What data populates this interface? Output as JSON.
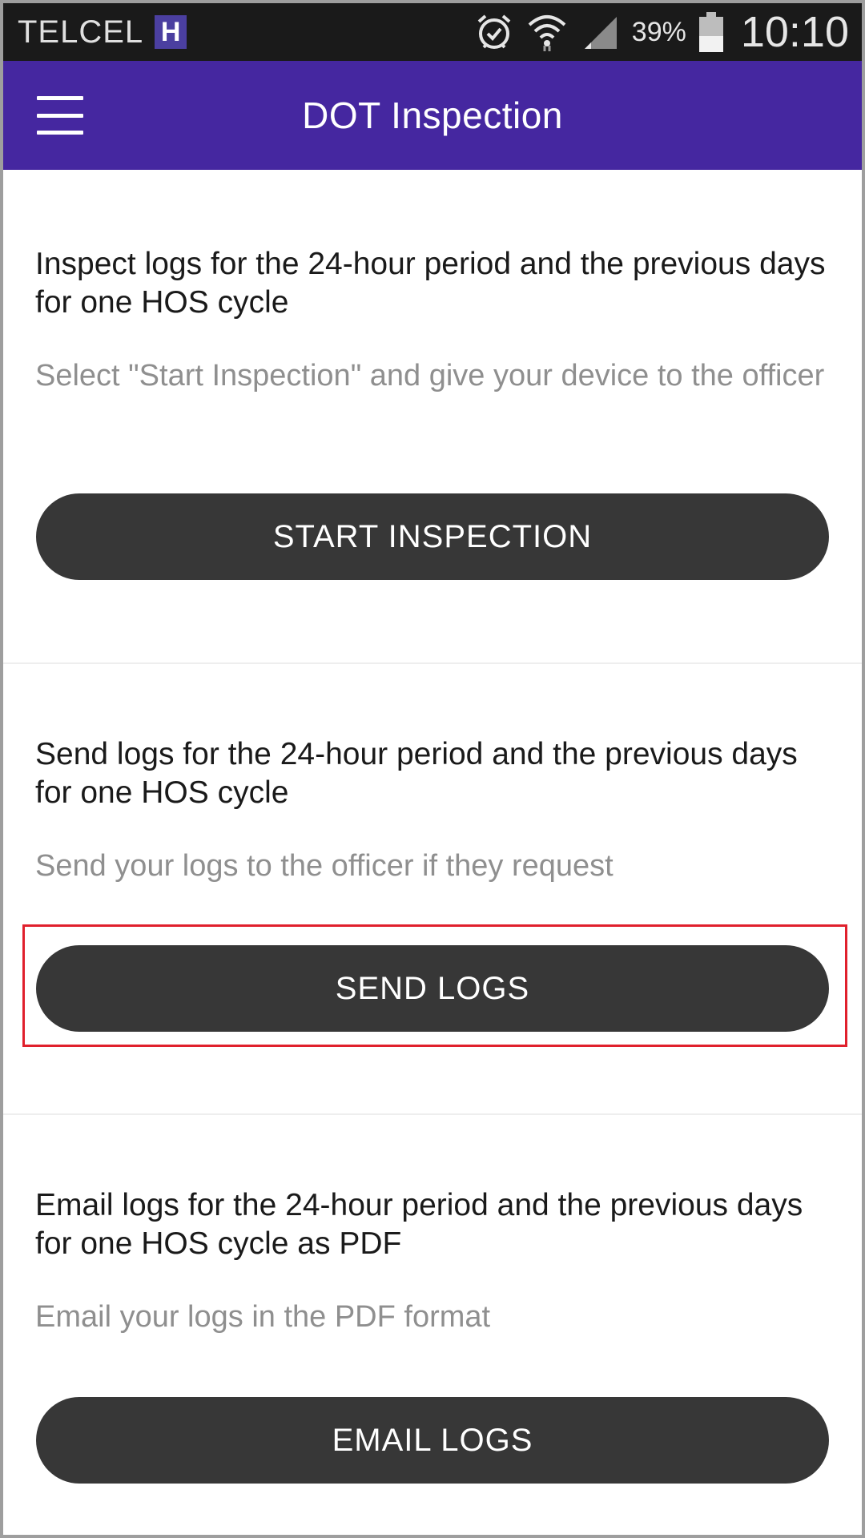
{
  "status_bar": {
    "carrier": "TELCEL",
    "network_badge": "H",
    "icons": [
      "alarm-icon",
      "wifi-icon",
      "signal-icon",
      "battery-icon"
    ],
    "battery_percent": "39%",
    "time": "10:10"
  },
  "app_bar": {
    "title": "DOT Inspection",
    "menu_icon": "hamburger-menu-icon",
    "background_color": "#4527a0"
  },
  "sections": [
    {
      "heading": "Inspect logs for the 24-hour period and the previous days for one HOS cycle",
      "subtext": "Select \"Start Inspection\" and give your device to the officer",
      "button_label": "START INSPECTION"
    },
    {
      "heading": "Send logs for the 24-hour period and the previous days for one HOS cycle",
      "subtext": "Send your logs to the officer if they request",
      "button_label": "SEND LOGS"
    },
    {
      "heading": "Email logs for the 24-hour period and the previous days for one HOS cycle as PDF",
      "subtext": "Email your logs in the PDF format",
      "button_label": "EMAIL LOGS"
    }
  ],
  "colors": {
    "button": "#373737",
    "subtext": "#8f8f8f",
    "highlight": "#e0202c"
  }
}
